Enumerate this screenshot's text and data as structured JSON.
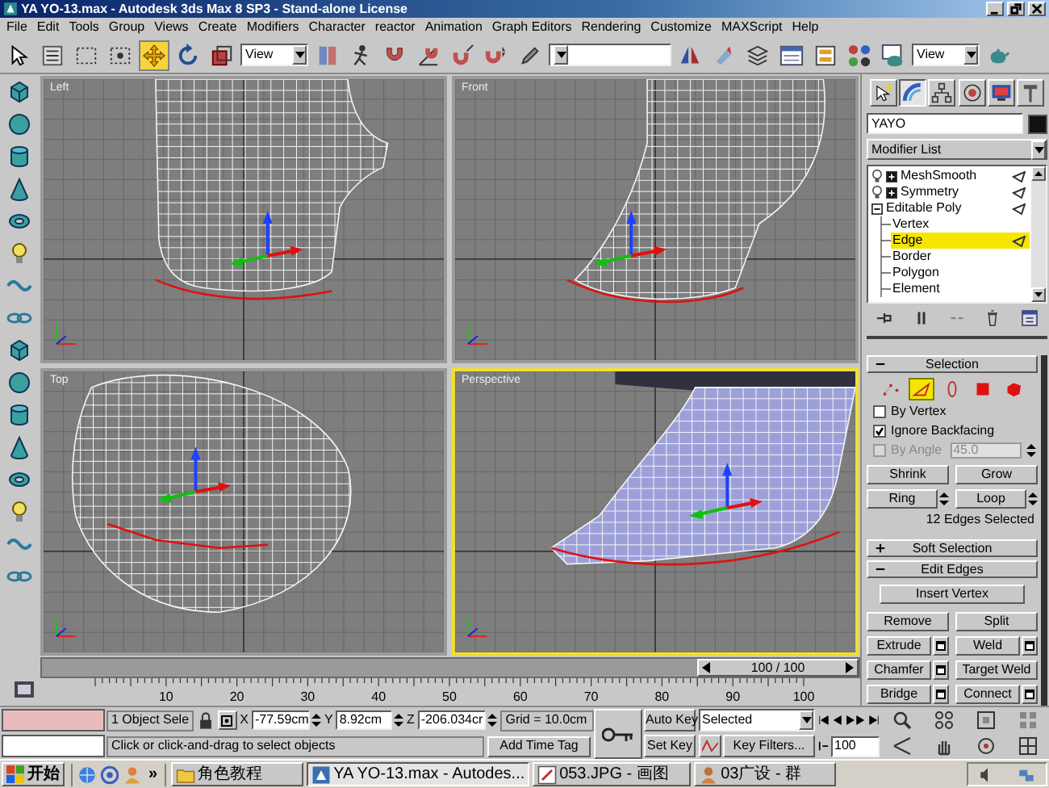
{
  "window": {
    "title": "YA YO-13.max - Autodesk 3ds Max 8 SP3 - Stand-alone License"
  },
  "menu": [
    "File",
    "Edit",
    "Tools",
    "Group",
    "Views",
    "Create",
    "Modifiers",
    "Character",
    "reactor",
    "Animation",
    "Graph Editors",
    "Rendering",
    "Customize",
    "MAXScript",
    "Help"
  ],
  "toolbar": [
    {
      "kind": "select",
      "selected": false
    },
    {
      "kind": "select_by_name",
      "selected": false
    },
    {
      "kind": "rect_region",
      "selected": false
    },
    {
      "kind": "window_crossing",
      "selected": false
    },
    {
      "kind": "move",
      "selected": true
    },
    {
      "kind": "rotate",
      "selected": false
    },
    {
      "kind": "scale",
      "selected": false
    },
    {
      "kind": "dropdown",
      "value": "View"
    },
    {
      "kind": "pivot",
      "selected": false
    },
    {
      "kind": "manipulate",
      "selected": false
    },
    {
      "kind": "snap",
      "selected": false
    },
    {
      "kind": "angle_snap",
      "selected": false
    },
    {
      "kind": "percent_snap",
      "selected": false
    },
    {
      "kind": "spinner_snap",
      "selected": false
    },
    {
      "kind": "edit_named",
      "selected": false
    },
    {
      "kind": "dropdown"
    },
    {
      "kind": "mirror",
      "selected": false
    },
    {
      "kind": "align",
      "selected": false
    },
    {
      "kind": "layers",
      "selected": false
    },
    {
      "kind": "curve_editor",
      "selected": false
    },
    {
      "kind": "schematic",
      "selected": false
    },
    {
      "kind": "material_editor",
      "selected": false
    },
    {
      "kind": "render_scene",
      "selected": false
    },
    {
      "kind": "dropdown",
      "value": "View"
    },
    {
      "kind": "quick_render",
      "selected": false
    }
  ],
  "viewports": [
    {
      "label": "Left",
      "selected": false
    },
    {
      "label": "Front",
      "selected": false
    },
    {
      "label": "Top",
      "selected": false
    },
    {
      "label": "Perspective",
      "selected": true
    }
  ],
  "command_panel": {
    "tabs": [
      {
        "kind": "create",
        "selected": false
      },
      {
        "kind": "modify",
        "selected": true
      },
      {
        "kind": "hierarchy",
        "selected": false
      },
      {
        "kind": "motion",
        "selected": false
      },
      {
        "kind": "display",
        "selected": false
      },
      {
        "kind": "utilities",
        "selected": false
      }
    ],
    "object_name": "YAYO",
    "modifier_list": "Modifier List",
    "stack": [
      {
        "label": "MeshSmooth",
        "on": true,
        "expanded": false
      },
      {
        "label": "Symmetry",
        "on": true,
        "expanded": false
      },
      {
        "label": "Editable Poly",
        "expanded": true,
        "children": [
          {
            "label": "Vertex",
            "selected": false
          },
          {
            "label": "Edge",
            "selected": true
          },
          {
            "label": "Border",
            "selected": false
          },
          {
            "label": "Polygon",
            "selected": false
          },
          {
            "label": "Element",
            "selected": false
          }
        ]
      }
    ],
    "selection": {
      "title": "Selection",
      "expanded": true,
      "subobjects": [
        {
          "kind": "vertex",
          "selected": false
        },
        {
          "kind": "edge",
          "selected": true
        },
        {
          "kind": "border",
          "selected": false
        },
        {
          "kind": "polygon",
          "selected": false
        },
        {
          "kind": "element",
          "selected": false
        }
      ],
      "options": [
        {
          "label": "By Vertex",
          "checked": false,
          "disabled": false
        },
        {
          "label": "Ignore Backfacing",
          "checked": true,
          "disabled": false
        },
        {
          "label": "By Angle",
          "checked": false,
          "disabled": true,
          "value": "45.0"
        }
      ],
      "shrink": "Shrink",
      "grow": "Grow",
      "ring": "Ring",
      "loop": "Loop",
      "status": "12 Edges Selected"
    },
    "soft_selection": {
      "title": "Soft Selection",
      "expanded": false
    },
    "edit_edges": {
      "title": "Edit Edges",
      "expanded": true,
      "buttons": [
        {
          "label": "Insert Vertex",
          "kind": "wide"
        },
        {
          "label": "Remove",
          "kind": "plain"
        },
        {
          "label": "Split",
          "kind": "plain"
        },
        {
          "label": "Extrude",
          "kind": "settings"
        },
        {
          "label": "Weld",
          "kind": "settings"
        },
        {
          "label": "Chamfer",
          "kind": "settings"
        },
        {
          "label": "Target Weld",
          "kind": "plain"
        },
        {
          "label": "Bridge",
          "kind": "settings"
        },
        {
          "label": "Connect",
          "kind": "settings"
        }
      ]
    }
  },
  "time_slider": {
    "label": "100 / 100",
    "level": 1
  },
  "track_bar": {
    "labels": [
      "10",
      "20",
      "30",
      "40",
      "50",
      "60",
      "70",
      "80",
      "90",
      "100"
    ]
  },
  "status": {
    "selection": "1 Object Sele",
    "x_label": "X",
    "x": "-77.59cm",
    "y_label": "Y",
    "y": "8.92cm",
    "z_label": "Z",
    "z": "-206.034cr",
    "grid": "Grid = 10.0cm",
    "prompt": "Click or click-and-drag to select objects",
    "time_tag": "Add Time Tag",
    "auto_key": "Auto Key",
    "set_key": "Set Key",
    "key_mode": "Selected",
    "key_filters": "Key Filters...",
    "frame": "100"
  },
  "taskbar": {
    "start": "开始",
    "more": "»",
    "tasks": [
      {
        "label": "角色教程",
        "kind": "folder",
        "selected": false
      },
      {
        "label": "YA YO-13.max - Autodes...",
        "kind": "max",
        "selected": true
      },
      {
        "label": "053.JPG - 画图",
        "kind": "paint",
        "selected": false
      },
      {
        "label": "03广设 - 群",
        "kind": "chat",
        "selected": false
      }
    ]
  }
}
